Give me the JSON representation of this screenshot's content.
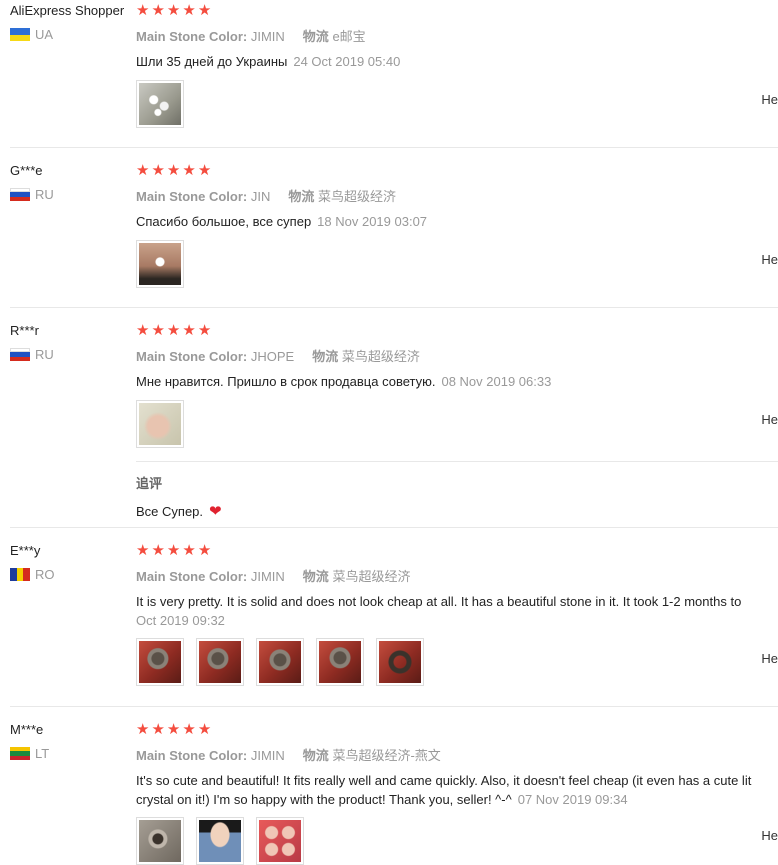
{
  "reviews": [
    {
      "user": "AliExpress Shopper",
      "country": "UA",
      "flag_colors": [
        "#2e6fd6",
        "#f6d917"
      ],
      "stars": 5,
      "key1": "Main Stone Color:",
      "val1": "JIMIN",
      "key2": "物流",
      "val2": "e邮宝",
      "text": "Шли 35 дней до Украины",
      "date": "24 Oct 2019 05:40",
      "photos": [
        {
          "type": "pearls"
        }
      ],
      "helpful": "He"
    },
    {
      "user": "G***e",
      "country": "RU",
      "flag_colors": [
        "#ffffff",
        "#1f52c4",
        "#d52b1e"
      ],
      "stars": 5,
      "key1": "Main Stone Color:",
      "val1": "JIN",
      "key2": "物流",
      "val2": "菜鸟超级经济",
      "text": "Спасибо большое, все супер",
      "date": "18 Nov 2019 03:07",
      "photos": [
        {
          "type": "earring"
        }
      ],
      "helpful": "He"
    },
    {
      "user": "R***r",
      "country": "RU",
      "flag_colors": [
        "#ffffff",
        "#1f52c4",
        "#d52b1e"
      ],
      "stars": 5,
      "key1": "Main Stone Color:",
      "val1": "JHOPE",
      "key2": "物流",
      "val2": "菜鸟超级经济",
      "text": "Мне нравится. Пришло в срок продавца советую.",
      "date": "08 Nov 2019 06:33",
      "photos": [
        {
          "type": "hand"
        }
      ],
      "helpful": "He",
      "followup_label": "追评",
      "followup_text": "Все Супер."
    },
    {
      "user": "E***y",
      "country": "RO",
      "flag_colors": [
        "#1f3c9c",
        "#f5d000",
        "#d52b1e"
      ],
      "stars": 5,
      "key1": "Main Stone Color:",
      "val1": "JIMIN",
      "key2": "物流",
      "val2": "菜鸟超级经济",
      "text": "It is very pretty. It is solid and does not look cheap at all. It has a beautiful stone in it. It took 1-2 months to",
      "date": "Oct 2019 09:32",
      "photos": [
        {
          "type": "ring"
        },
        {
          "type": "ring"
        },
        {
          "type": "ring"
        },
        {
          "type": "ring"
        },
        {
          "type": "ringside"
        }
      ],
      "helpful": "He"
    },
    {
      "user": "M***e",
      "country": "LT",
      "flag_colors": [
        "#f5c400",
        "#1a8a3e",
        "#c8232c"
      ],
      "stars": 5,
      "key1": "Main Stone Color:",
      "val1": "JIMIN",
      "key2": "物流",
      "val2": "菜鸟超级经济-燕文",
      "text": "It's so cute and beautiful! It fits really well and came quickly. Also, it doesn't feel cheap (it even has a cute lit",
      "text2": "crystal on it!) I'm so happy with the product! Thank you, seller! ^-^",
      "date": "07 Nov 2019 09:34",
      "photos": [
        {
          "type": "ringgray"
        },
        {
          "type": "person"
        },
        {
          "type": "persongrid"
        }
      ],
      "helpful": "He"
    }
  ]
}
